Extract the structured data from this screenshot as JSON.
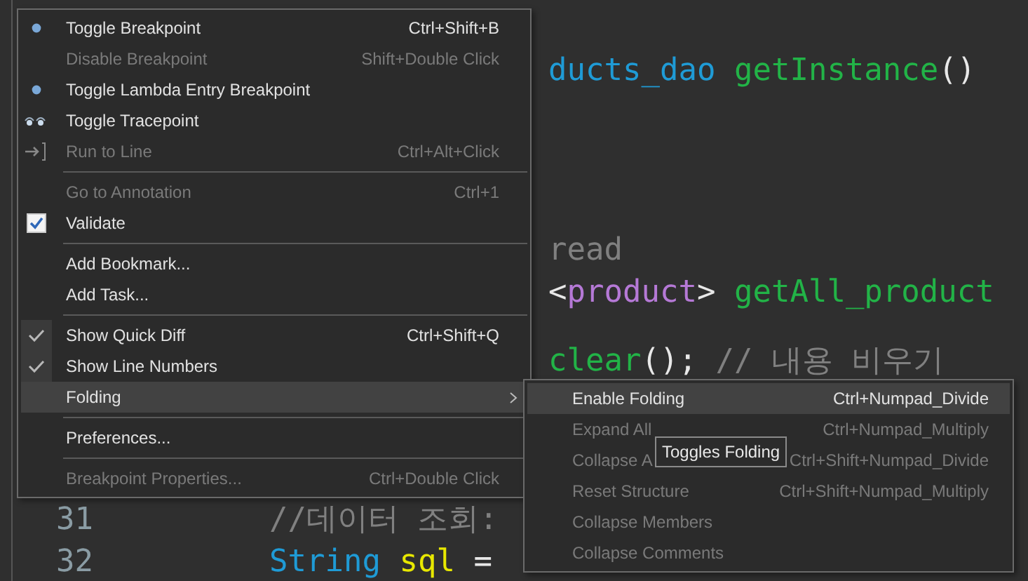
{
  "editor": {
    "lines": [
      {
        "tokens": [
          {
            "kind": "type",
            "text": "ducts_dao"
          },
          {
            "kind": "method",
            "text": " getInstance"
          },
          {
            "kind": "plain",
            "text": "()"
          }
        ]
      },
      {
        "tokens": [
          {
            "kind": "comment",
            "text": "read"
          }
        ]
      },
      {
        "tokens": [
          {
            "kind": "plain",
            "text": "<"
          },
          {
            "kind": "generic",
            "text": "product"
          },
          {
            "kind": "plain",
            "text": "> "
          },
          {
            "kind": "method",
            "text": "getAll_product"
          }
        ]
      },
      {
        "tokens": [
          {
            "kind": "method",
            "text": "clear"
          },
          {
            "kind": "plain",
            "text": "(); "
          },
          {
            "kind": "comment",
            "text": "// 내용 비우기"
          }
        ]
      },
      {
        "number": "31",
        "tokens": [
          {
            "kind": "comment",
            "text": "//데이터 조회:"
          }
        ]
      },
      {
        "number": "32",
        "tokens": [
          {
            "kind": "type",
            "text": "String"
          },
          {
            "kind": "variable",
            "text": " sql"
          },
          {
            "kind": "plain",
            "text": " ="
          }
        ]
      }
    ]
  },
  "context_menu": {
    "items": [
      {
        "kind": "breakpoint",
        "label": "Toggle Breakpoint",
        "shortcut": "Ctrl+Shift+B",
        "disabled": false,
        "selected": false
      },
      {
        "kind": "plain",
        "label": "Disable Breakpoint",
        "shortcut": "Shift+Double Click",
        "disabled": true,
        "selected": false
      },
      {
        "kind": "breakpoint",
        "label": "Toggle Lambda Entry Breakpoint",
        "disabled": false,
        "selected": false
      },
      {
        "kind": "tracepoint",
        "label": "Toggle Tracepoint",
        "disabled": false,
        "selected": false
      },
      {
        "kind": "run-to-line",
        "label": "Run to Line",
        "shortcut": "Ctrl+Alt+Click",
        "disabled": true,
        "selected": false
      },
      {
        "kind": "separator"
      },
      {
        "kind": "plain",
        "label": "Go to Annotation",
        "shortcut": "Ctrl+1",
        "disabled": true,
        "selected": false
      },
      {
        "kind": "checkbox",
        "checked": true,
        "label": "Validate",
        "disabled": false,
        "selected": false
      },
      {
        "kind": "separator"
      },
      {
        "kind": "plain",
        "label": "Add Bookmark...",
        "disabled": false,
        "selected": false
      },
      {
        "kind": "plain",
        "label": "Add Task...",
        "disabled": false,
        "selected": false
      },
      {
        "kind": "separator"
      },
      {
        "kind": "check",
        "checked": true,
        "label": "Show Quick Diff",
        "shortcut": "Ctrl+Shift+Q",
        "disabled": false,
        "selected": false
      },
      {
        "kind": "check",
        "checked": true,
        "label": "Show Line Numbers",
        "disabled": false,
        "selected": false
      },
      {
        "kind": "plain",
        "label": "Folding",
        "submenu": true,
        "disabled": false,
        "selected": true
      },
      {
        "kind": "separator"
      },
      {
        "kind": "plain",
        "label": "Preferences...",
        "disabled": false,
        "selected": false
      },
      {
        "kind": "separator"
      },
      {
        "kind": "plain",
        "label": "Breakpoint Properties...",
        "shortcut": "Ctrl+Double Click",
        "disabled": true,
        "selected": false
      }
    ]
  },
  "folding_submenu": {
    "items": [
      {
        "kind": "plain",
        "label": "Enable Folding",
        "shortcut": "Ctrl+Numpad_Divide",
        "disabled": false,
        "selected": true
      },
      {
        "kind": "plain",
        "label": "Expand All",
        "shortcut": "Ctrl+Numpad_Multiply",
        "disabled": true,
        "selected": false
      },
      {
        "kind": "plain",
        "label": "Collapse A",
        "shortcut": "Ctrl+Shift+Numpad_Divide",
        "disabled": true,
        "selected": false
      },
      {
        "kind": "plain",
        "label": "Reset Structure",
        "shortcut": "Ctrl+Shift+Numpad_Multiply",
        "disabled": true,
        "selected": false
      },
      {
        "kind": "plain",
        "label": "Collapse Members",
        "disabled": true,
        "selected": false
      },
      {
        "kind": "plain",
        "label": "Collapse Comments",
        "disabled": true,
        "selected": false
      }
    ]
  },
  "tooltip": {
    "text": "Toggles Folding"
  }
}
